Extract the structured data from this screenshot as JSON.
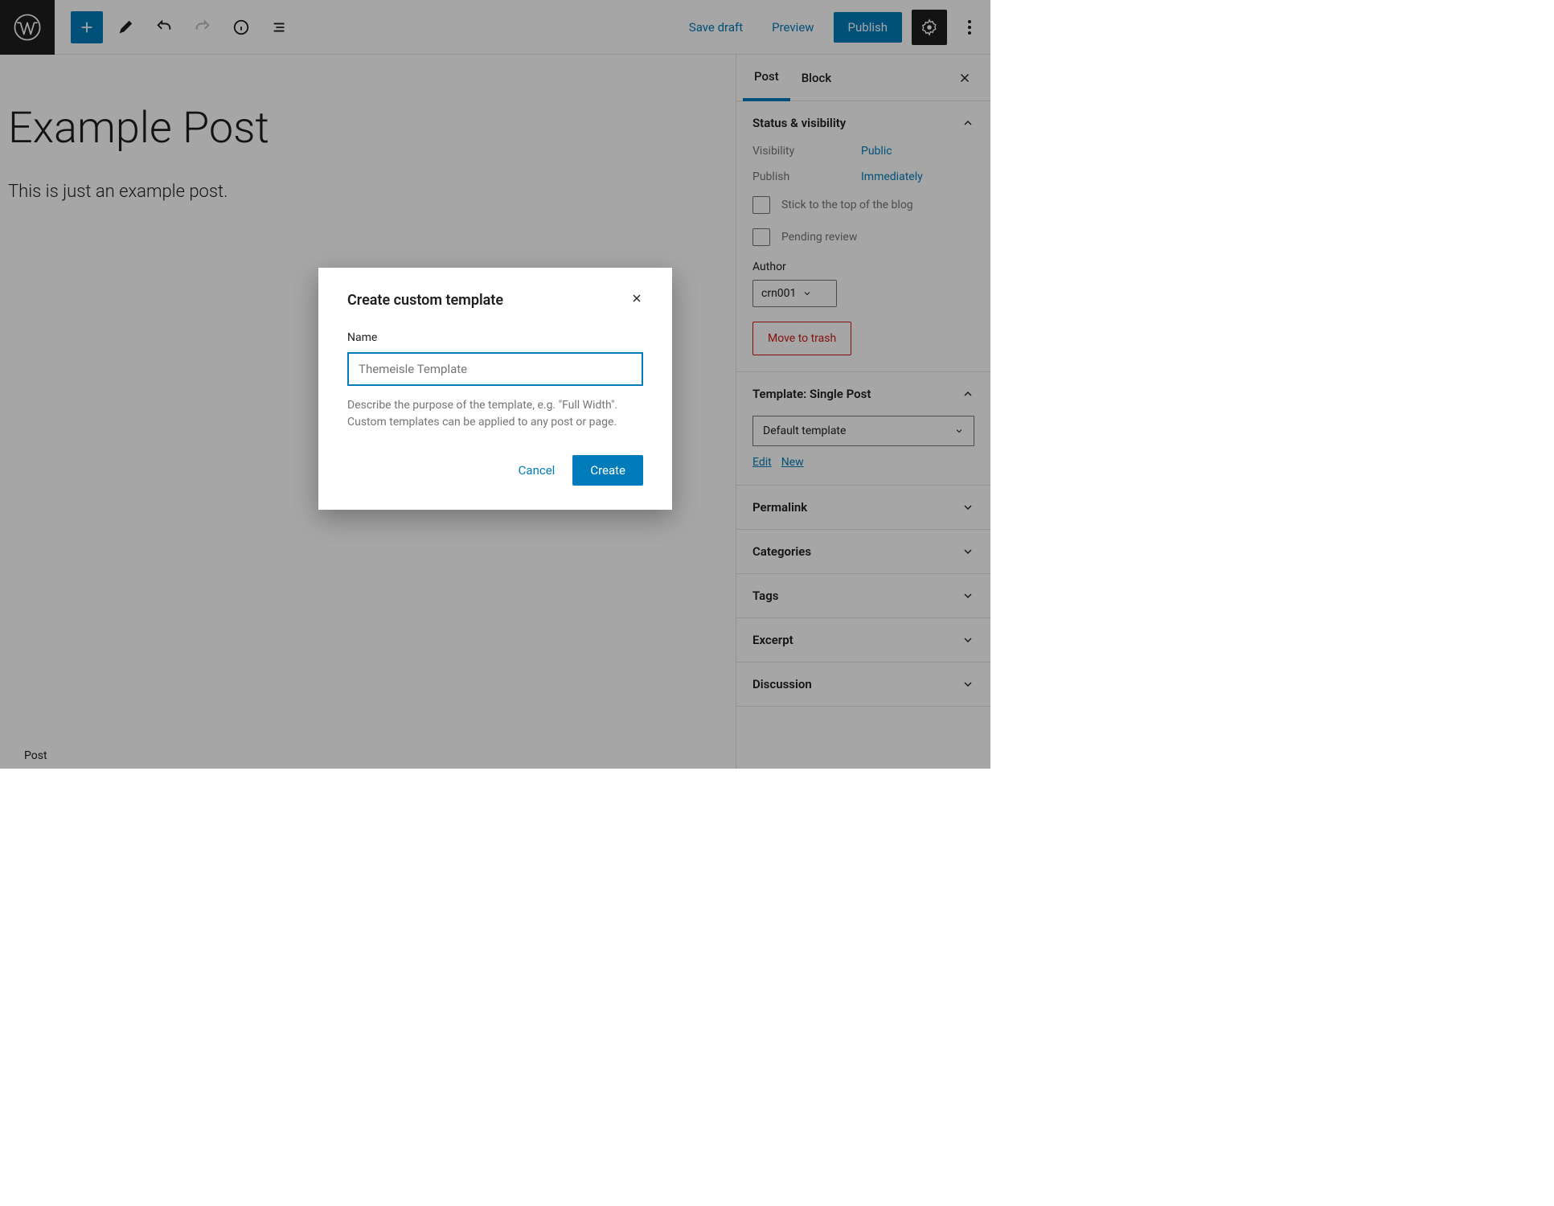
{
  "toolbar": {
    "save_draft": "Save draft",
    "preview": "Preview",
    "publish": "Publish"
  },
  "editor": {
    "title": "Example Post",
    "body": "This is just an example post."
  },
  "tabs": {
    "post": "Post",
    "block": "Block"
  },
  "panels": {
    "status": {
      "title": "Status & visibility",
      "visibility_label": "Visibility",
      "visibility_value": "Public",
      "publish_label": "Publish",
      "publish_value": "Immediately",
      "sticky": "Stick to the top of the blog",
      "pending": "Pending review",
      "author_label": "Author",
      "author_value": "crn001",
      "trash": "Move to trash"
    },
    "template": {
      "title": "Template: Single Post",
      "selected": "Default template",
      "edit": "Edit",
      "new": "New"
    },
    "permalink": "Permalink",
    "categories": "Categories",
    "tags": "Tags",
    "excerpt": "Excerpt",
    "discussion": "Discussion"
  },
  "footer": {
    "breadcrumb": "Post"
  },
  "modal": {
    "title": "Create custom template",
    "name_label": "Name",
    "name_value": "Themeisle Template",
    "help": "Describe the purpose of the template, e.g. \"Full Width\". Custom templates can be applied to any post or page.",
    "cancel": "Cancel",
    "create": "Create"
  }
}
